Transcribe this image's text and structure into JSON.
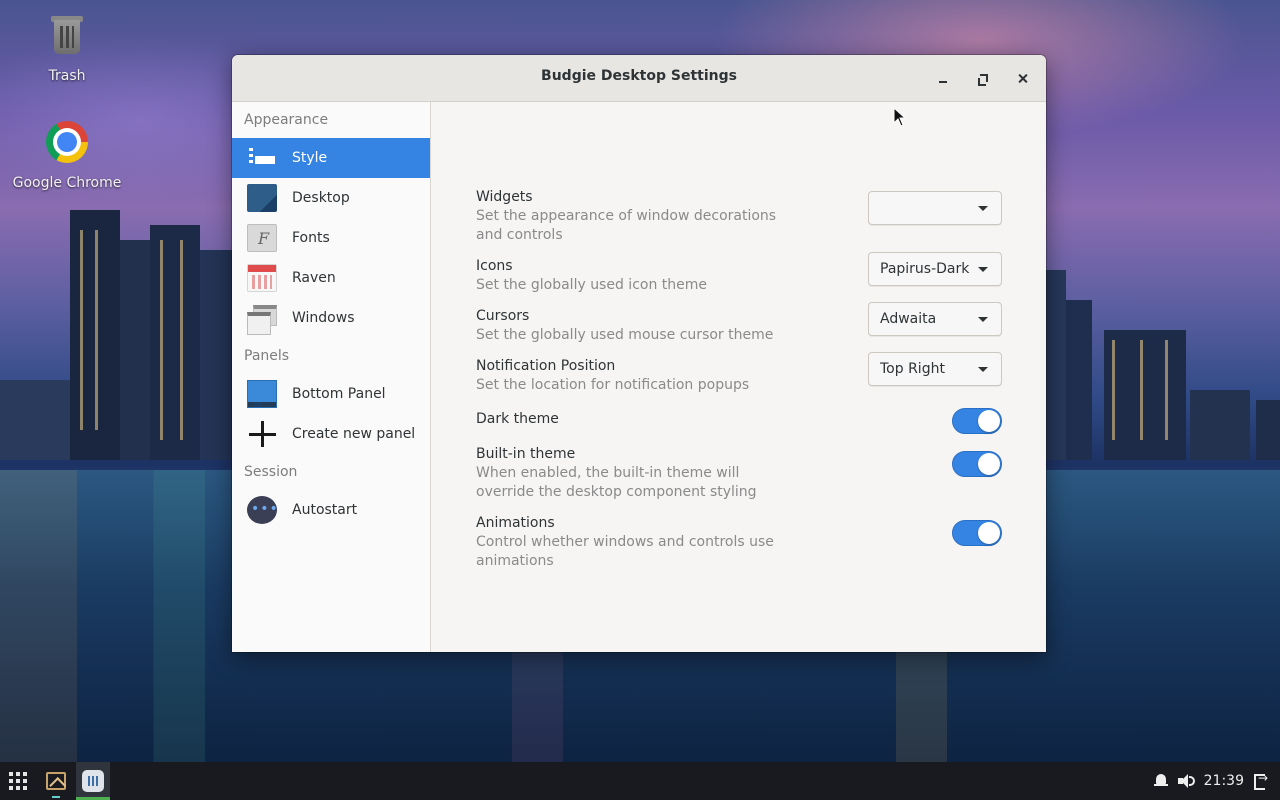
{
  "desktop": {
    "icons": [
      {
        "label": "Trash",
        "icon": "trash-icon"
      },
      {
        "label": "Google Chrome",
        "icon": "chrome-icon"
      }
    ]
  },
  "window": {
    "title": "Budgie Desktop Settings",
    "controls": {
      "minimize": "minimize-icon",
      "maximize": "maximize-icon",
      "close": "close-icon"
    }
  },
  "sidebar": {
    "sections": [
      {
        "heading": "Appearance",
        "items": [
          {
            "label": "Style",
            "icon": "style-icon",
            "active": true
          },
          {
            "label": "Desktop",
            "icon": "desktop-icon"
          },
          {
            "label": "Fonts",
            "icon": "fonts-icon"
          },
          {
            "label": "Raven",
            "icon": "raven-icon"
          },
          {
            "label": "Windows",
            "icon": "windows-icon"
          }
        ]
      },
      {
        "heading": "Panels",
        "items": [
          {
            "label": "Bottom Panel",
            "icon": "panel-icon"
          },
          {
            "label": "Create new panel",
            "icon": "plus-icon"
          }
        ]
      },
      {
        "heading": "Session",
        "items": [
          {
            "label": "Autostart",
            "icon": "autostart-icon"
          }
        ]
      }
    ]
  },
  "settings": {
    "widgets": {
      "name": "Widgets",
      "desc": "Set the appearance of window decorations and controls",
      "value": ""
    },
    "icons": {
      "name": "Icons",
      "desc": "Set the globally used icon theme",
      "value": "Papirus-Dark"
    },
    "cursors": {
      "name": "Cursors",
      "desc": "Set the globally used mouse cursor theme",
      "value": "Adwaita"
    },
    "notification_position": {
      "name": "Notification Position",
      "desc": "Set the location for notification popups",
      "value": "Top Right"
    },
    "dark_theme": {
      "name": "Dark theme",
      "desc": "",
      "enabled": true
    },
    "builtin_theme": {
      "name": "Built-in theme",
      "desc": "When enabled, the built-in theme will override the desktop component styling",
      "enabled": true
    },
    "animations": {
      "name": "Animations",
      "desc": "Control whether windows and controls use animations",
      "enabled": true
    }
  },
  "taskbar": {
    "clock": "21:39",
    "icons": [
      "apps-grid-icon",
      "text-editor-icon",
      "settings-app-icon",
      "bell-icon",
      "volume-icon",
      "logout-icon"
    ]
  },
  "colors": {
    "accent": "#3584e4",
    "window_bg": "#f6f5f4",
    "taskbar_bg": "#181a1f"
  }
}
